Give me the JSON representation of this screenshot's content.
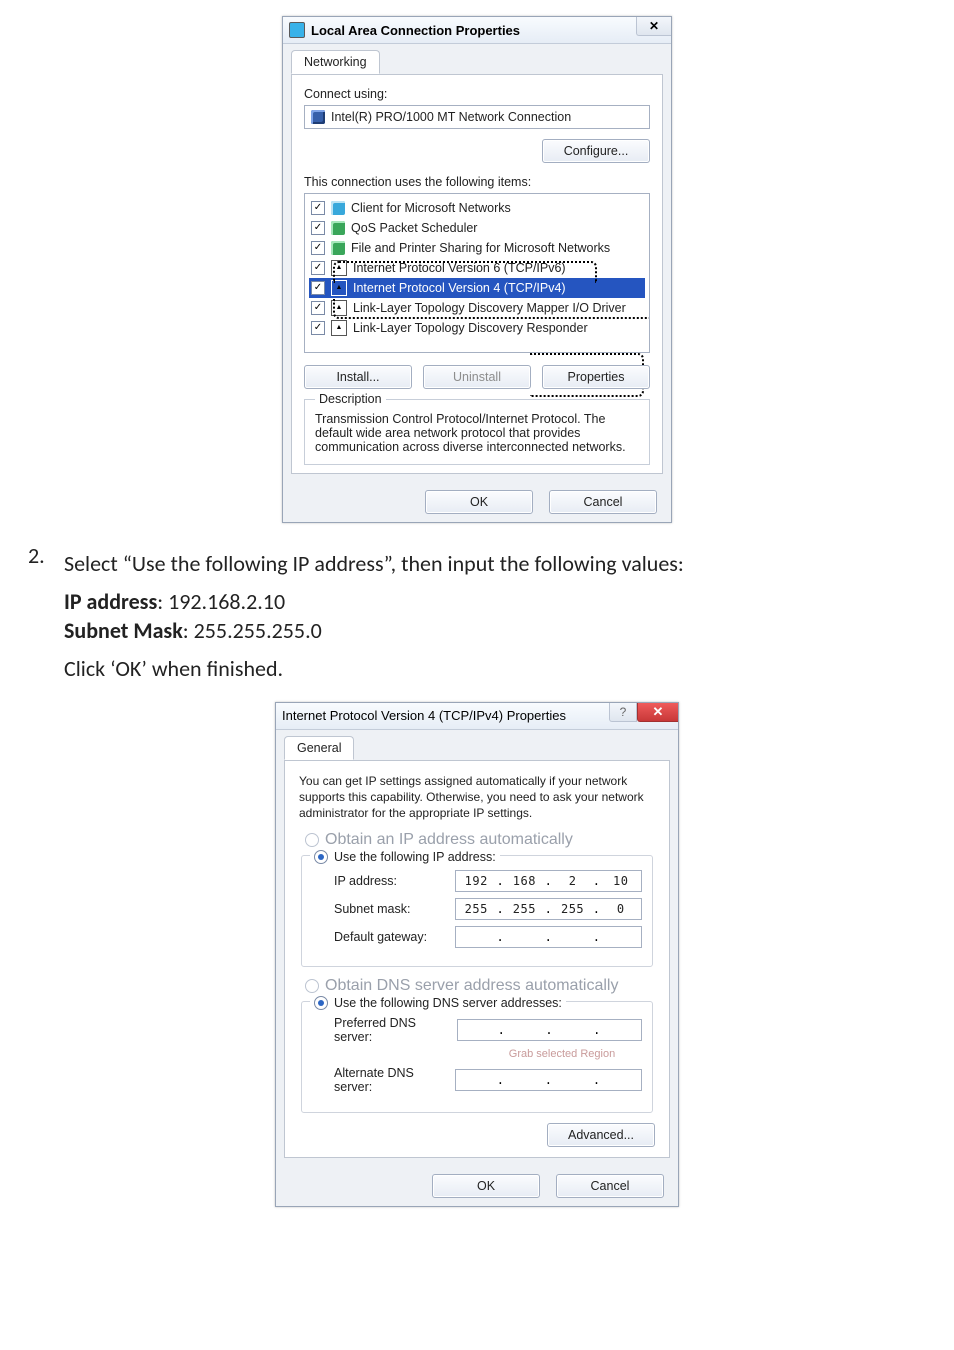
{
  "dialog1": {
    "title": "Local Area Connection Properties",
    "tab_networking": "Networking",
    "connect_using_label": "Connect using:",
    "nic_name": "Intel(R) PRO/1000 MT Network Connection",
    "configure_btn": "Configure...",
    "items_label": "This connection uses the following items:",
    "items": [
      "Client for Microsoft Networks",
      "QoS Packet Scheduler",
      "File and Printer Sharing for Microsoft Networks",
      "Internet Protocol Version 6 (TCP/IPv6)",
      "Internet Protocol Version 4 (TCP/IPv4)",
      "Link-Layer Topology Discovery Mapper I/O Driver",
      "Link-Layer Topology Discovery Responder"
    ],
    "install_btn": "Install...",
    "uninstall_btn": "Uninstall",
    "properties_btn": "Properties",
    "desc_label": "Description",
    "desc_text": "Transmission Control Protocol/Internet Protocol. The default wide area network protocol that provides communication across diverse interconnected networks.",
    "ok_btn": "OK",
    "cancel_btn": "Cancel",
    "close_glyph": "✕"
  },
  "doc": {
    "step_num": "2.",
    "step_text": "Select “Use the following IP address”, then input the following values:",
    "ip_label_bold": "IP address",
    "ip_value": ": 192.168.2.10",
    "mask_label_bold": "Subnet Mask",
    "mask_value": ": 255.255.255.0",
    "click_ok": "Click ‘OK’ when finished."
  },
  "dialog2": {
    "title": "Internet Protocol Version 4 (TCP/IPv4) Properties",
    "tab_general": "General",
    "intro": "You can get IP settings assigned automatically if your network supports this capability. Otherwise, you need to ask your network administrator for the appropriate IP settings.",
    "radio_auto_ip": "Obtain an IP address automatically",
    "radio_use_ip": "Use the following IP address:",
    "row_ip": "IP address:",
    "row_mask": "Subnet mask:",
    "row_gw": "Default gateway:",
    "ip_octets": [
      "192",
      "168",
      "2",
      "10"
    ],
    "mask_octets": [
      "255",
      "255",
      "255",
      "0"
    ],
    "gw_octets": [
      "",
      "",
      "",
      ""
    ],
    "radio_auto_dns": "Obtain DNS server address automatically",
    "radio_use_dns": "Use the following DNS server addresses:",
    "row_pdns": "Preferred DNS server:",
    "row_adns": "Alternate DNS server:",
    "pdns_octets": [
      "",
      "",
      "",
      ""
    ],
    "adns_octets": [
      "",
      "",
      "",
      ""
    ],
    "faint_caption": "Grab selected Region",
    "advanced_btn": "Advanced...",
    "ok_btn": "OK",
    "cancel_btn": "Cancel",
    "help_glyph": "?",
    "close_glyph": "✕"
  }
}
